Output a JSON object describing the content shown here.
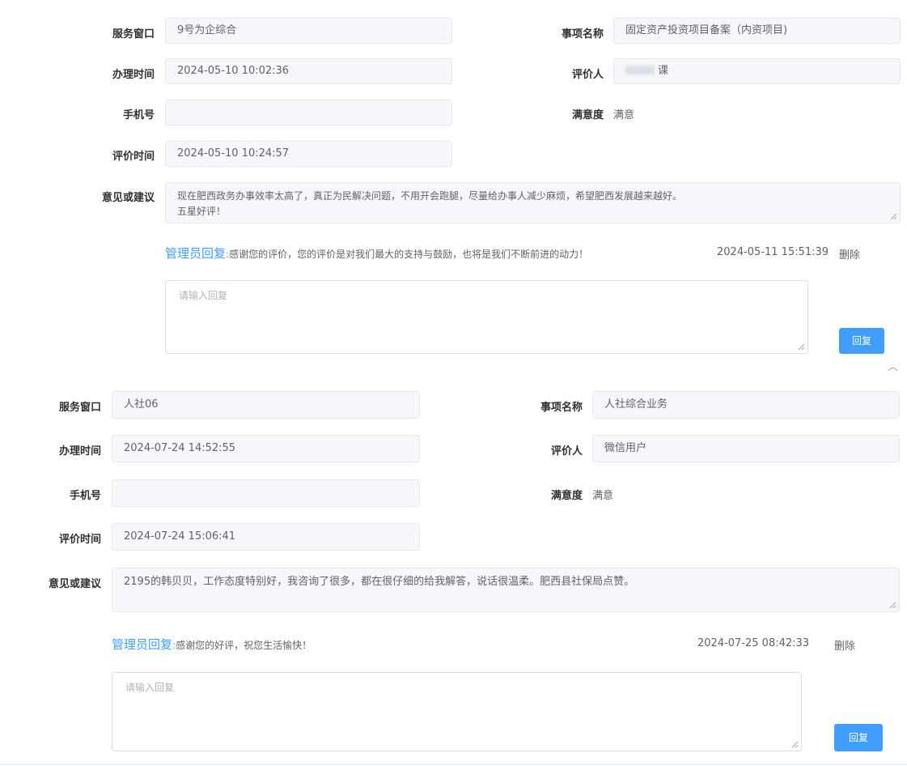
{
  "records": [
    {
      "labels": {
        "service_window": "服务窗口",
        "item_name": "事项名称",
        "handle_time": "办理时间",
        "evaluator": "评价人",
        "phone": "手机号",
        "satisfaction": "满意度",
        "eval_time": "评价时间",
        "opinion": "意见或建议"
      },
      "service_window": "9号为企综合",
      "item_name": "固定资产投资项目备案（内资项目)",
      "handle_time": "2024-05-10 10:02:36",
      "evaluator": "课",
      "phone": "",
      "satisfaction": "满意",
      "eval_time": "2024-05-10 10:24:57",
      "opinion_line1": "现在肥西政务办事效率太高了，真正为民解决问题，不用开会跑腿，尽量给办事人减少麻烦，希望肥西发展越来越好。",
      "opinion_line2": "五星好评！",
      "admin_label": "管理员回复",
      "separator": ":",
      "admin_reply": "感谢您的评价，您的评价是对我们最大的支持与鼓励，也将是我们不断前进的动力！",
      "reply_time": "2024-05-11 15:51:39",
      "delete_label": "删除",
      "reply_placeholder": "请输入回复",
      "reply_button": "回复"
    },
    {
      "labels": {
        "service_window": "服务窗口",
        "item_name": "事项名称",
        "handle_time": "办理时间",
        "evaluator": "评价人",
        "phone": "手机号",
        "satisfaction": "满意度",
        "eval_time": "评价时间",
        "opinion": "意见或建议"
      },
      "service_window": "人社06",
      "item_name": "人社综合业务",
      "handle_time": "2024-07-24 14:52:55",
      "evaluator": "微信用户",
      "phone": "",
      "satisfaction": "满意",
      "eval_time": "2024-07-24 15:06:41",
      "opinion_line1": "2195的韩贝贝，工作态度特别好，我咨询了很多，都在很仔细的给我解答，说话很温柔。肥西县社保局点赞。",
      "admin_label": "管理员回复",
      "separator": ":",
      "admin_reply": "感谢您的好评，祝您生活愉快！",
      "reply_time": "2024-07-25  08:42:33",
      "delete_label": "删除",
      "reply_placeholder": "请输入回复",
      "reply_button": "回复"
    }
  ],
  "icons": {
    "collapse": "chevron-up-icon",
    "resize": "resize-grip-icon"
  }
}
